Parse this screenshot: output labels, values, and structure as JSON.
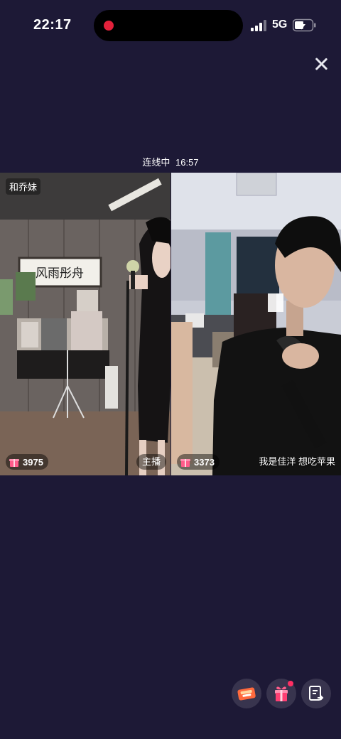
{
  "status_bar": {
    "time": "22:17",
    "network": "5G"
  },
  "link": {
    "label": "连线中",
    "duration": "16:57"
  },
  "left_stream": {
    "name": "和乔妹",
    "gift_count": "3975",
    "role_tag": "主播",
    "calligraphy": "风雨彤舟"
  },
  "right_stream": {
    "gift_count": "3373",
    "nickname": "我是佳洋 想吃苹果"
  },
  "bottom_actions": [
    {
      "icon": "coupon-icon"
    },
    {
      "icon": "gift-icon"
    },
    {
      "icon": "share-document-icon"
    }
  ],
  "colors": {
    "background": "#1d1936",
    "accent_pink": "#ff2e63",
    "recording": "#e3213b"
  }
}
